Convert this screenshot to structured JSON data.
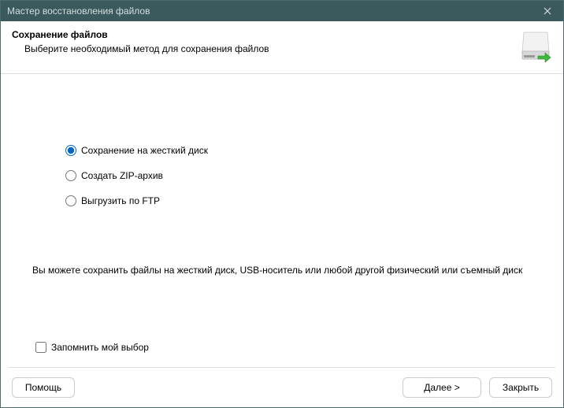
{
  "titlebar": {
    "title": "Мастер восстановления файлов"
  },
  "header": {
    "title": "Сохранение файлов",
    "subtitle": "Выберите необходимый метод для сохранения файлов"
  },
  "radios": {
    "opt1": "Сохранение на жесткий диск",
    "opt2": "Создать ZIP-архив",
    "opt3": "Выгрузить по FTP"
  },
  "description": "Вы можете сохранить файлы на жесткий диск, USB-носитель или любой другой физический или съемный диск",
  "remember": "Запомнить мой выбор",
  "footer": {
    "help": "Помощь",
    "next": "Далее >",
    "close": "Закрыть"
  }
}
